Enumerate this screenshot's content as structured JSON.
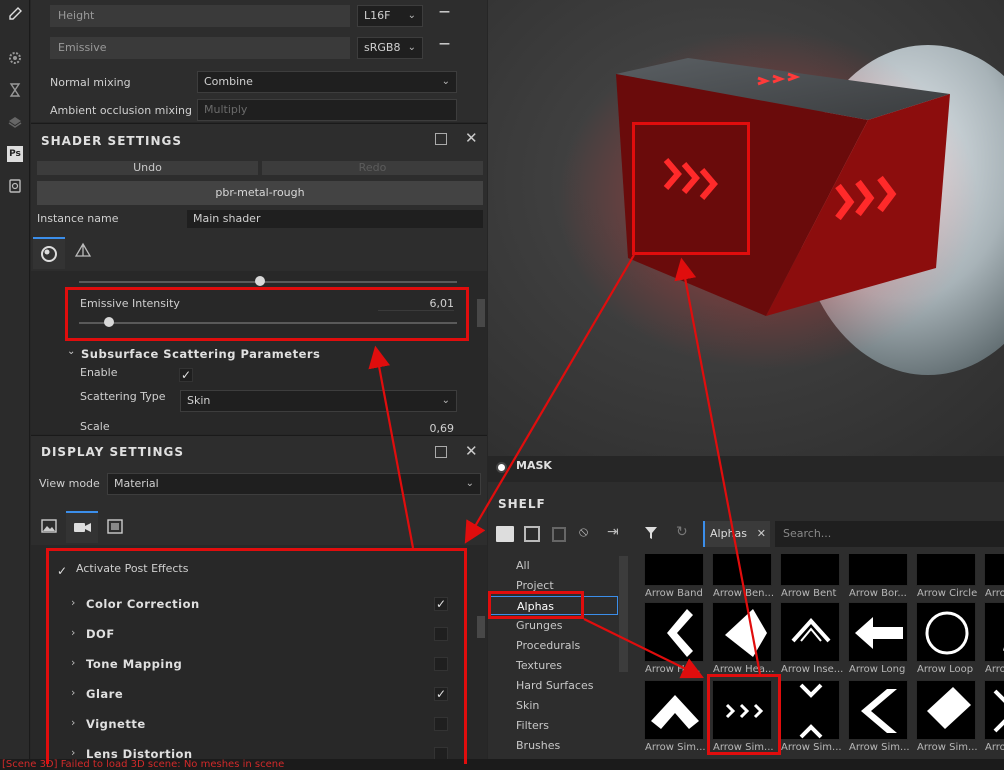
{
  "toolbar": {
    "icons": [
      "eyedropper-icon",
      "gear-icon",
      "hourglass-icon",
      "layers-icon",
      "photoshop-icon",
      "camera-icon"
    ],
    "ps_label": "Ps"
  },
  "texture_set": {
    "channels": [
      {
        "name": "Height",
        "format": "L16F"
      },
      {
        "name": "Emissive",
        "format": "sRGB8"
      }
    ],
    "normal_mixing_label": "Normal mixing",
    "normal_mixing_value": "Combine",
    "ao_mixing_label": "Ambient occlusion mixing",
    "ao_mixing_value": "Multiply",
    "remove_glyph": "—"
  },
  "shader_settings": {
    "title": "SHADER SETTINGS",
    "undo": "Undo",
    "redo": "Redo",
    "shader_name": "pbr-metal-rough",
    "instance_label": "Instance name",
    "instance_value": "Main shader",
    "emissive_label": "Emissive Intensity",
    "emissive_value": "6,01",
    "emissive_fraction": 0.08,
    "prev_slider_fraction": 0.48,
    "subsurface_title": "Subsurface Scattering Parameters",
    "enable_label": "Enable",
    "enable_checked": true,
    "scattering_type_label": "Scattering Type",
    "scattering_type_value": "Skin",
    "scale_label": "Scale",
    "scale_value": "0,69"
  },
  "display_settings": {
    "title": "DISPLAY SETTINGS",
    "view_mode_label": "View mode",
    "view_mode_value": "Material",
    "activate_post_effects": "Activate Post Effects",
    "effects": [
      {
        "label": "Color Correction",
        "checked": true
      },
      {
        "label": "DOF",
        "checked": false
      },
      {
        "label": "Tone Mapping",
        "checked": false
      },
      {
        "label": "Glare",
        "checked": true
      },
      {
        "label": "Vignette",
        "checked": false
      },
      {
        "label": "Lens Distortion",
        "checked": false
      }
    ]
  },
  "mask_label": "MASK",
  "shelf": {
    "title": "SHELF",
    "filter_tag": "Alphas",
    "search_placeholder": "Search...",
    "categories": [
      "All",
      "Project",
      "Alphas",
      "Grunges",
      "Procedurals",
      "Textures",
      "Hard Surfaces",
      "Skin",
      "Filters",
      "Brushes"
    ],
    "selected_category": "Alphas",
    "row1": [
      "Arrow Band",
      "Arrow Ben...",
      "Arrow Bent",
      "Arrow Bor...",
      "Arrow Circle",
      "Arro"
    ],
    "row2": [
      "Arrow He...",
      "Arrow Hea...",
      "Arrow Inse...",
      "Arrow Long",
      "Arrow Loop",
      "Arro"
    ],
    "row3": [
      "Arrow Sim...",
      "Arrow Sim...",
      "Arrow Sim...",
      "Arrow Sim...",
      "Arrow Sim...",
      "Arro"
    ]
  },
  "status_bar": "[Scene 3D] Failed to load 3D scene: No meshes in scene",
  "colors": {
    "annotation": "#e00d0d",
    "accent": "#3b8eea",
    "emissive": "#ff2020"
  }
}
